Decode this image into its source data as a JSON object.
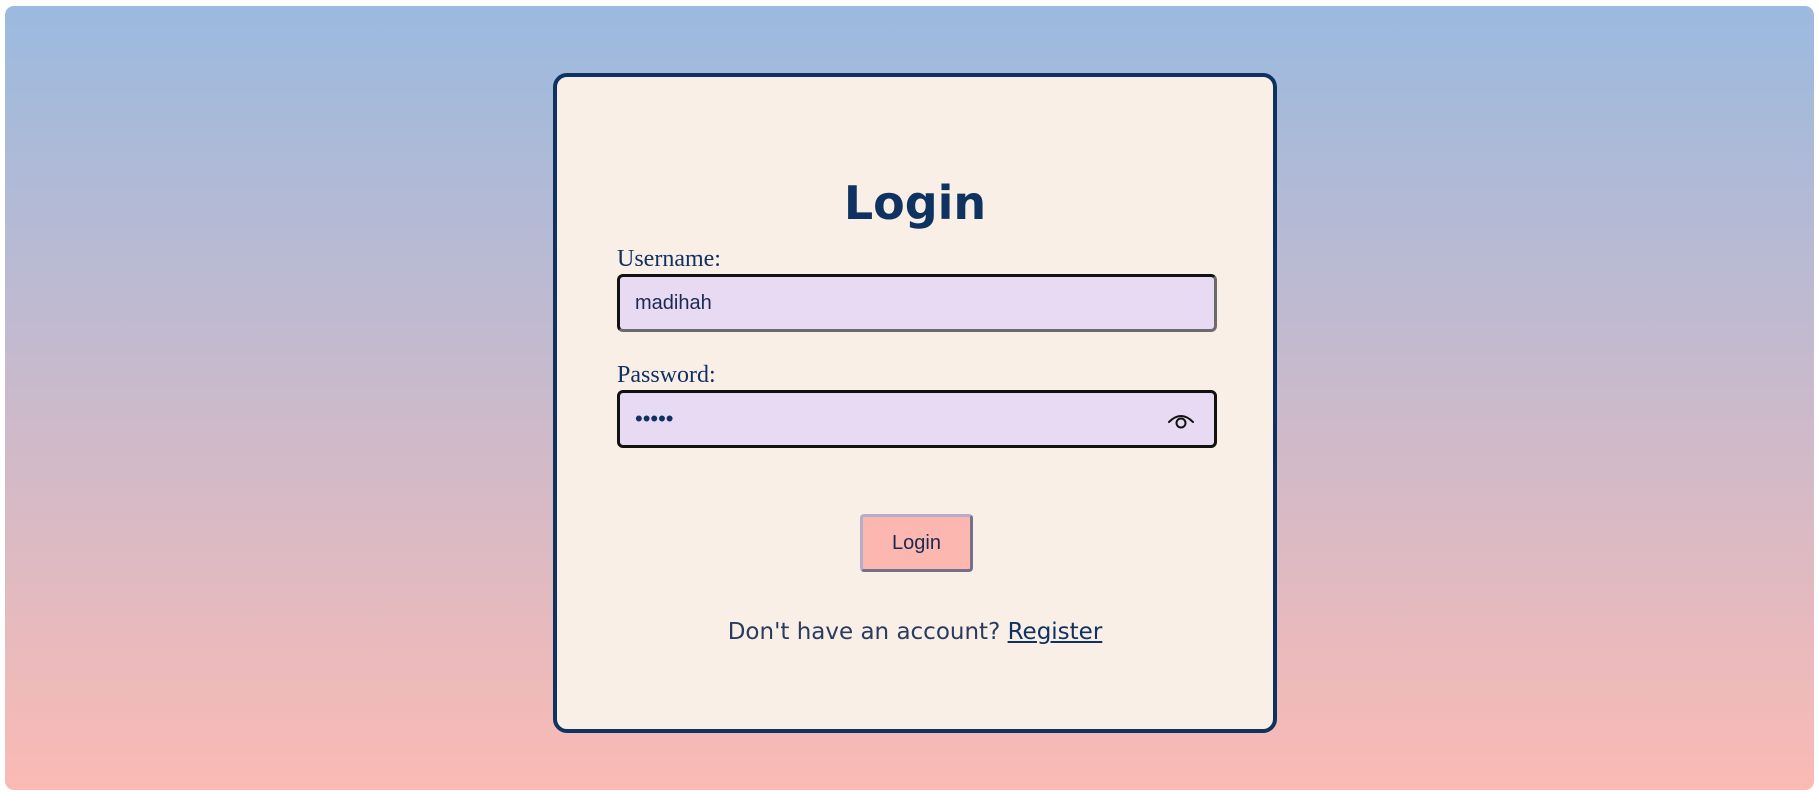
{
  "login_form": {
    "title": "Login",
    "username_label": "Username:",
    "username_value": "madihah",
    "password_label": "Password:",
    "password_value": "•••••",
    "submit_label": "Login",
    "register_prompt": "Don't have an account?",
    "register_link": "Register",
    "show_password_icon": "eye-icon"
  },
  "colors": {
    "background_top": "#9bbadf",
    "background_bottom": "#fbbab4",
    "card_background": "#faefe6",
    "card_border": "#103261",
    "input_background": "#e7daf2",
    "button_background": "#fcb7b0",
    "text_primary": "#103261"
  }
}
